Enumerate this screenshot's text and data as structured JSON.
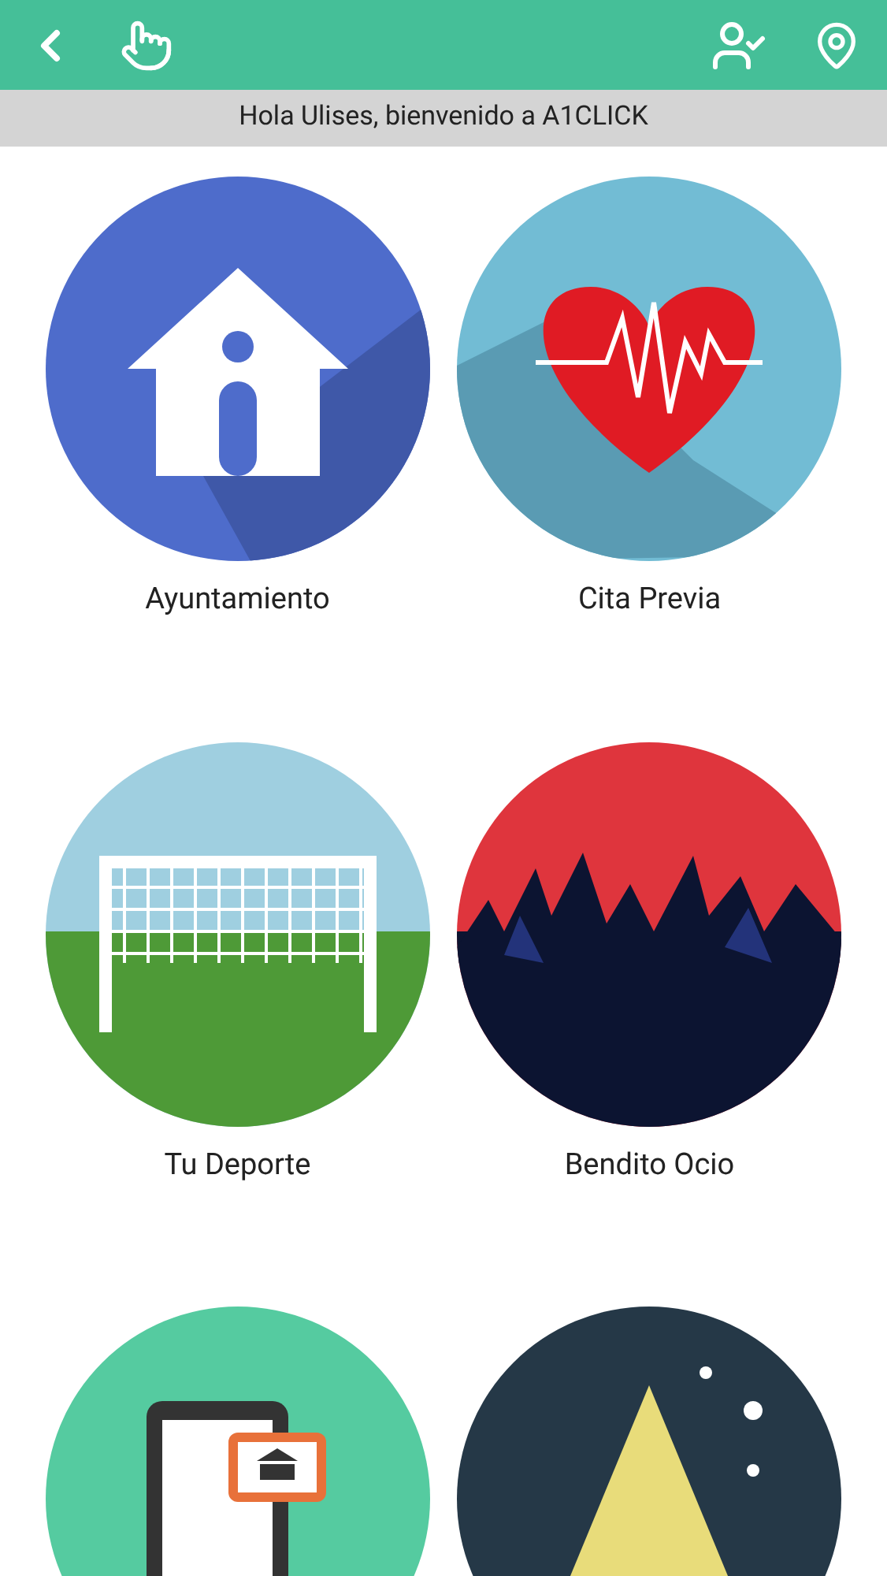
{
  "top_bar": {
    "greeting": "Hola Ulises, bienvenido a A1CLICK"
  },
  "tiles": [
    {
      "kind": "house",
      "label": "Ayuntamiento"
    },
    {
      "kind": "heart",
      "label": "Cita Previa"
    },
    {
      "kind": "goal",
      "label": "Tu Deporte"
    },
    {
      "kind": "crowd",
      "label": "Bendito Ocio"
    },
    {
      "kind": "tablet"
    },
    {
      "kind": "tent"
    }
  ]
}
